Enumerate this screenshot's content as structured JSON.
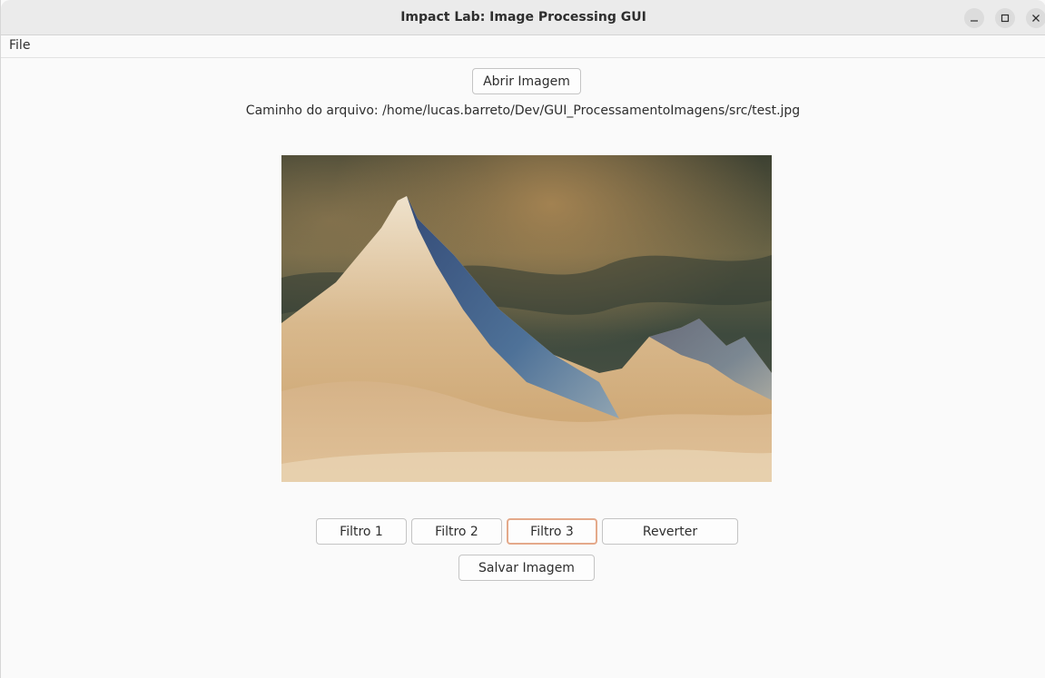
{
  "window": {
    "title": "Impact Lab: Image Processing GUI",
    "controls": [
      "minimize-icon",
      "maximize-icon",
      "close-icon"
    ]
  },
  "menubar": {
    "items": [
      {
        "label": "File"
      }
    ]
  },
  "main": {
    "open_button_label": "Abrir Imagem",
    "path_text": "Caminho do arquivo: /home/lucas.barreto/Dev/GUI_ProcessamentoImagens/src/test.jpg",
    "image_description": "mountain-photo",
    "filter_buttons": [
      {
        "label": "Filtro 1"
      },
      {
        "label": "Filtro 2"
      },
      {
        "label": "Filtro 3"
      },
      {
        "label": "Reverter"
      }
    ],
    "save_button_label": "Salvar Imagem"
  },
  "colors": {
    "focus_accent": "#e4a98a",
    "titlebar": "#ebebeb",
    "background": "#fafafa"
  }
}
